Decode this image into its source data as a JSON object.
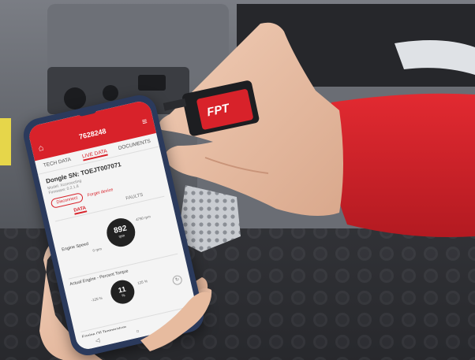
{
  "phone": {
    "header_title": "7628248",
    "tabs": [
      "TECH DATA",
      "LIVE DATA",
      "DOCUMENTS"
    ],
    "active_tab": "LIVE DATA",
    "dongle_label": "Dongle SN: TOEJT007071",
    "dongle_sub1": "Model: Xconnecting",
    "dongle_sub2": "Firmware: 0.2.1.8",
    "disconnect_label": "Disconnect",
    "forget_label": "Forget device",
    "subtabs": [
      "DATA",
      "FAULTS"
    ],
    "engine_speed_label": "Engine Speed",
    "engine_speed_value": "892",
    "engine_speed_unit": "rpm",
    "engine_speed_min": "0 rpm",
    "engine_speed_max": "4750 rpm",
    "torque_label": "Actual Engine - Percent Torque",
    "torque_value": "11",
    "torque_unit": "%",
    "torque_min": "-125 %",
    "torque_max": "125 %",
    "next_label": "Engine Oil Temperature"
  },
  "dongle": {
    "brand": "FPT"
  },
  "colors": {
    "brand_red": "#d8222a",
    "sleeve_red": "#d9232b",
    "cabin_grey": "#5e6168",
    "floor_dark": "#2a2b2f",
    "skin": "#e8bfa5"
  }
}
